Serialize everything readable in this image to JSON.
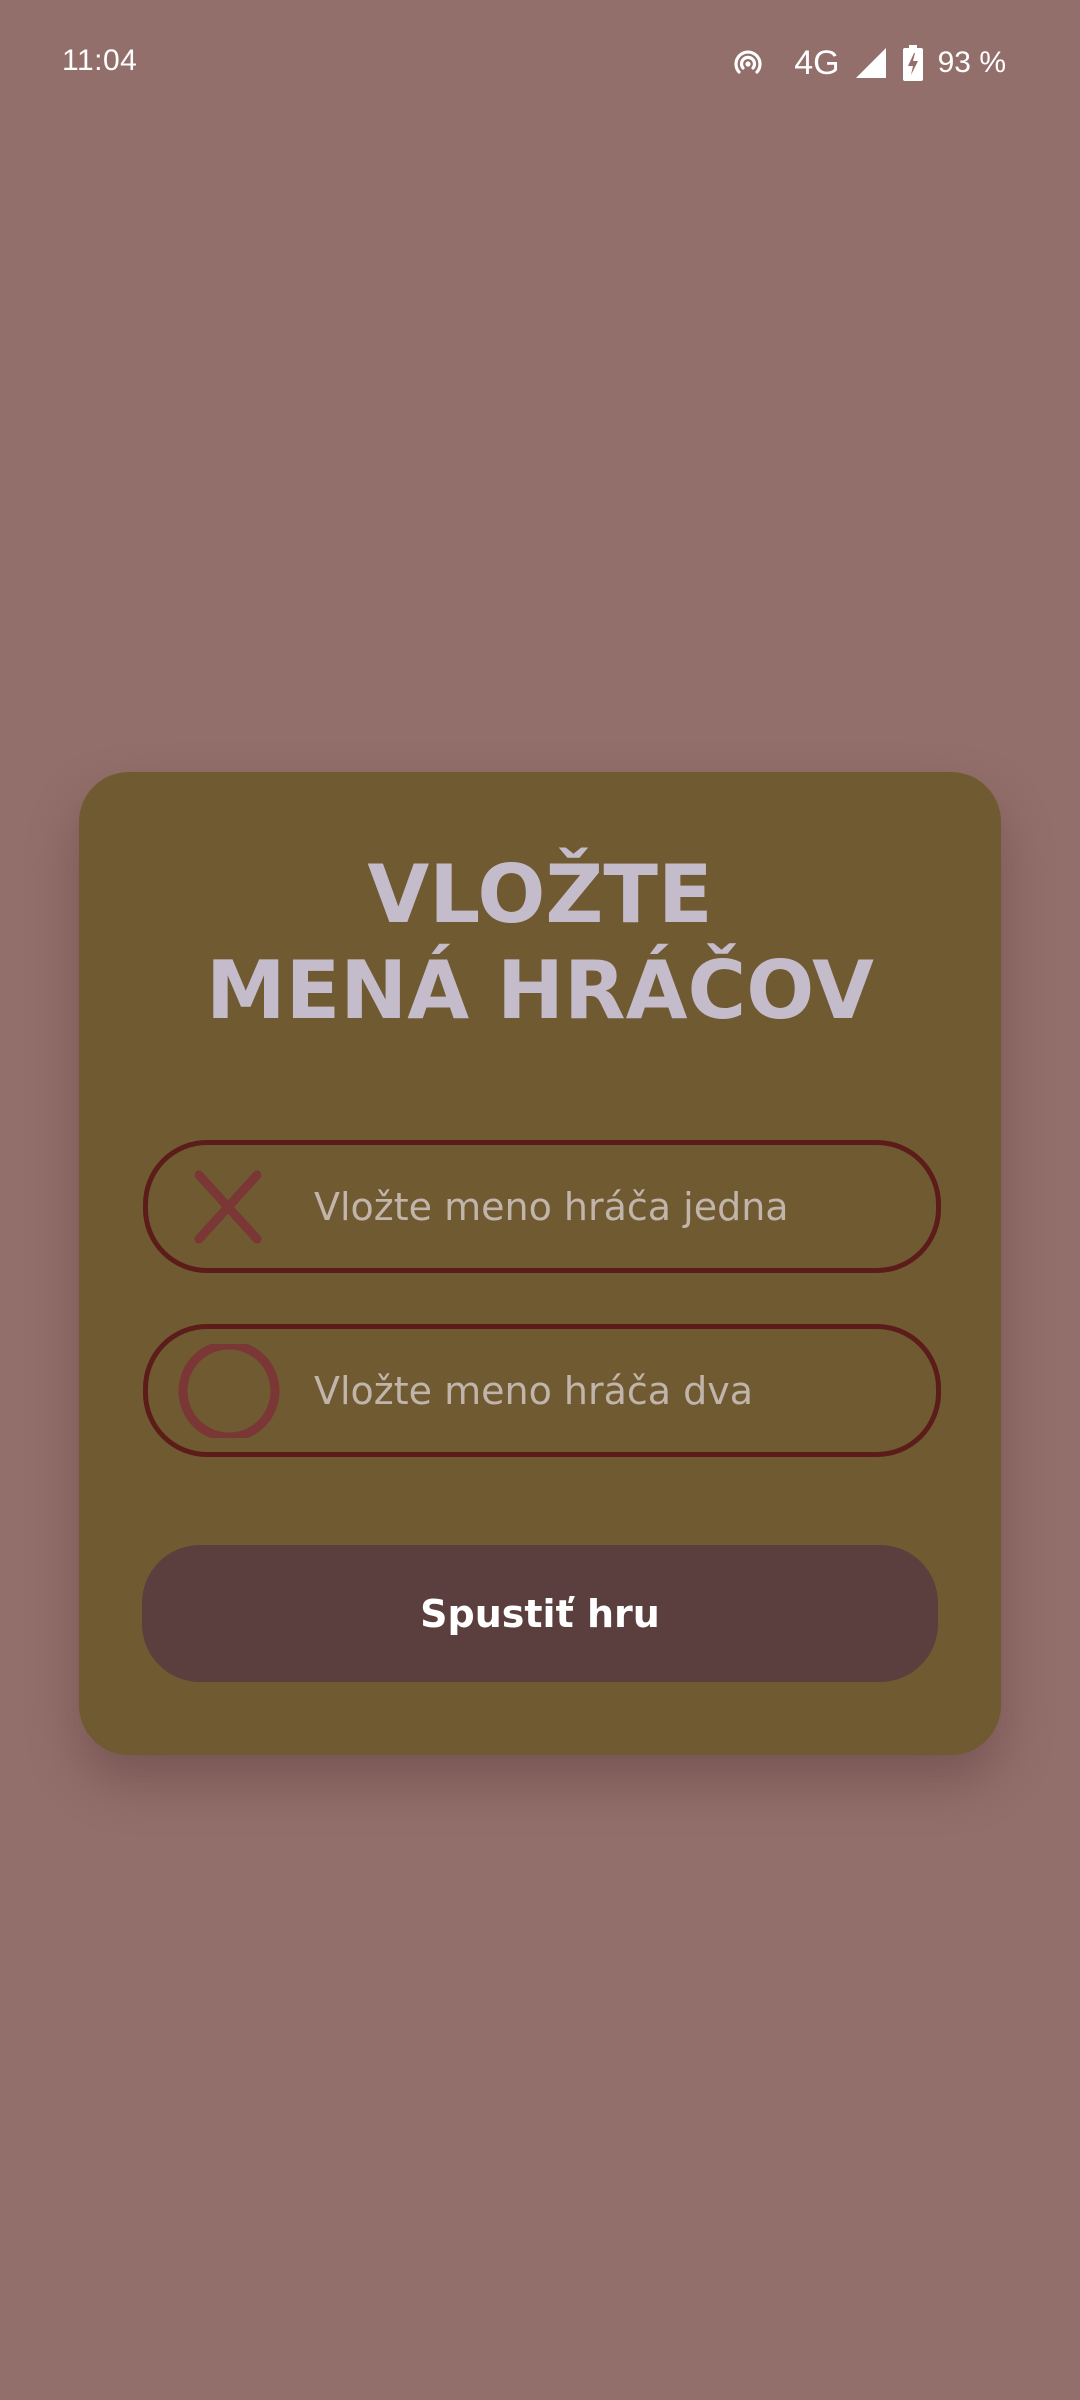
{
  "status_bar": {
    "time": "11:04",
    "network": "4G",
    "battery": "93 %",
    "icons": [
      "hotspot-icon",
      "signal-icon",
      "battery-charging-icon"
    ]
  },
  "colors": {
    "background": "#936f6b",
    "card": "#705a31",
    "title_text": "#c5bccb",
    "field_border": "#5b1c1a",
    "player_mark": "#7b3636",
    "button": "#5b3e3e",
    "button_text": "#ffffff"
  },
  "card": {
    "title_line1": "VLOŽTE",
    "title_line2": "MENÁ HRÁČOV",
    "player_one": {
      "icon": "cross-icon",
      "placeholder": "Vložte meno hráča jedna",
      "value": ""
    },
    "player_two": {
      "icon": "circle-icon",
      "placeholder": "Vložte meno hráča dva",
      "value": ""
    },
    "start_label": "Spustiť hru"
  }
}
